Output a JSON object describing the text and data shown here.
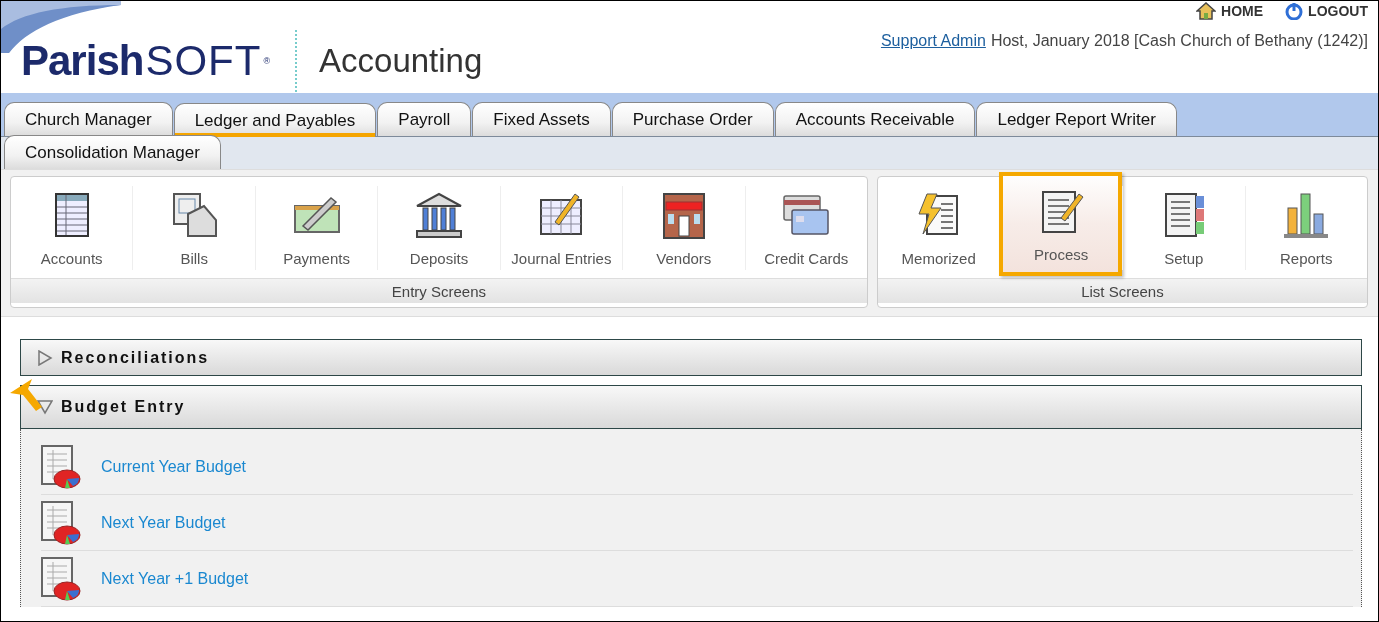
{
  "header": {
    "logo": {
      "part_1": "Parish",
      "part_2": "SOFT",
      "mark": "®"
    },
    "app_title": "Accounting",
    "top_links": [
      {
        "kind": "home",
        "label": "HOME"
      },
      {
        "kind": "logout",
        "label": "LOGOUT"
      }
    ],
    "user_line": {
      "user": "Support Admin",
      "context": "Host, January 2018 [Cash Church of Bethany (1242)]"
    }
  },
  "tabs": [
    [
      {
        "label": "Church Manager",
        "selected": false
      },
      {
        "label": "Ledger and Payables",
        "selected": true
      },
      {
        "label": "Payroll",
        "selected": false
      },
      {
        "label": "Fixed Assets",
        "selected": false
      },
      {
        "label": "Purchase Order",
        "selected": false
      },
      {
        "label": "Accounts Receivable",
        "selected": false
      },
      {
        "label": "Ledger Report Writer",
        "selected": false
      }
    ],
    [
      {
        "label": "Consolidation Manager",
        "selected": false
      }
    ]
  ],
  "toolbar_groups": [
    {
      "title": "Entry Screens",
      "items": [
        {
          "kind": "accounts",
          "label": "Accounts",
          "highlighted": false
        },
        {
          "kind": "bills",
          "label": "Bills",
          "highlighted": false
        },
        {
          "kind": "payments",
          "label": "Payments",
          "highlighted": false
        },
        {
          "kind": "deposits",
          "label": "Deposits",
          "highlighted": false
        },
        {
          "kind": "journal",
          "label": "Journal Entries",
          "highlighted": false
        },
        {
          "kind": "vendors",
          "label": "Vendors",
          "highlighted": false
        },
        {
          "kind": "cards",
          "label": "Credit Cards",
          "highlighted": false
        }
      ]
    },
    {
      "title": "List Screens",
      "items": [
        {
          "kind": "memorized",
          "label": "Memorized",
          "highlighted": false
        },
        {
          "kind": "process",
          "label": "Process",
          "highlighted": true
        },
        {
          "kind": "setup",
          "label": "Setup",
          "highlighted": false
        },
        {
          "kind": "reports",
          "label": "Reports",
          "highlighted": false
        }
      ]
    }
  ],
  "sections": [
    {
      "title": "Reconciliations",
      "expanded": false,
      "pointer": false
    },
    {
      "title": "Budget Entry",
      "expanded": true,
      "pointer": true,
      "items": [
        "Current Year Budget",
        "Next Year Budget",
        "Next Year +1 Budget"
      ]
    }
  ]
}
